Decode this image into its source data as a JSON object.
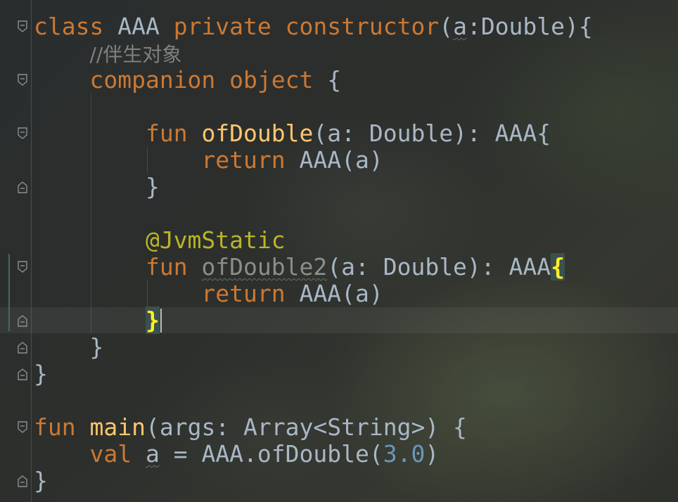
{
  "editor": {
    "language": "Kotlin",
    "colors": {
      "keyword": "#cc7832",
      "function": "#ffc66d",
      "plain": "#a9b7c6",
      "comment": "#808080",
      "annotation": "#bbb529",
      "number": "#6897bb",
      "brace_match": "#ffef28"
    },
    "current_line": 12,
    "lines": [
      {
        "n": 1,
        "tokens": [
          [
            "kw",
            "class "
          ],
          [
            "pl",
            "AAA "
          ],
          [
            "kw",
            "private constructor"
          ],
          [
            "pl",
            "("
          ],
          [
            "weak",
            "a"
          ],
          [
            "pl",
            ":Double){"
          ]
        ]
      },
      {
        "n": 2,
        "tokens": [
          [
            "pl",
            "    "
          ],
          [
            "cm",
            "//伴生对象"
          ]
        ]
      },
      {
        "n": 3,
        "tokens": [
          [
            "pl",
            "    "
          ],
          [
            "kw",
            "companion object "
          ],
          [
            "pl",
            "{"
          ]
        ]
      },
      {
        "n": 4,
        "tokens": []
      },
      {
        "n": 5,
        "tokens": [
          [
            "pl",
            "        "
          ],
          [
            "kw",
            "fun "
          ],
          [
            "fn",
            "ofDouble"
          ],
          [
            "pl",
            "(a: Double): AAA{"
          ]
        ]
      },
      {
        "n": 6,
        "tokens": [
          [
            "pl",
            "            "
          ],
          [
            "kw",
            "return "
          ],
          [
            "pl",
            "AAA(a)"
          ]
        ]
      },
      {
        "n": 7,
        "tokens": [
          [
            "pl",
            "        }"
          ]
        ]
      },
      {
        "n": 8,
        "tokens": []
      },
      {
        "n": 9,
        "tokens": [
          [
            "pl",
            "        "
          ],
          [
            "an",
            "@JvmStatic"
          ]
        ]
      },
      {
        "n": 10,
        "tokens": [
          [
            "pl",
            "        "
          ],
          [
            "kw",
            "fun "
          ],
          [
            "unused",
            "ofDouble2"
          ],
          [
            "pl",
            "(a: Double): AAA"
          ],
          [
            "brace",
            "{"
          ]
        ]
      },
      {
        "n": 11,
        "tokens": [
          [
            "pl",
            "            "
          ],
          [
            "kw",
            "return "
          ],
          [
            "pl",
            "AAA(a)"
          ]
        ]
      },
      {
        "n": 12,
        "tokens": [
          [
            "pl",
            "        "
          ],
          [
            "brace",
            "}"
          ],
          [
            "caret",
            ""
          ]
        ]
      },
      {
        "n": 13,
        "tokens": [
          [
            "pl",
            "    }"
          ]
        ]
      },
      {
        "n": 14,
        "tokens": [
          [
            "pl",
            "}"
          ]
        ]
      },
      {
        "n": 15,
        "tokens": []
      },
      {
        "n": 16,
        "tokens": [
          [
            "kw",
            "fun "
          ],
          [
            "fn",
            "main"
          ],
          [
            "pl",
            "(args: Array<String>) {"
          ]
        ]
      },
      {
        "n": 17,
        "tokens": [
          [
            "pl",
            "    "
          ],
          [
            "kw",
            "val "
          ],
          [
            "weak",
            "a"
          ],
          [
            "pl",
            " = AAA.ofDouble("
          ],
          [
            "num",
            "3.0"
          ],
          [
            "pl",
            ")"
          ]
        ]
      },
      {
        "n": 18,
        "tokens": [
          [
            "pl",
            "}"
          ]
        ]
      }
    ]
  },
  "gutter": {
    "fold_markers": [
      {
        "line": 1,
        "kind": "fold-open"
      },
      {
        "line": 3,
        "kind": "fold-open"
      },
      {
        "line": 5,
        "kind": "fold-open"
      },
      {
        "line": 7,
        "kind": "fold-close"
      },
      {
        "line": 10,
        "kind": "fold-open"
      },
      {
        "line": 12,
        "kind": "fold-close"
      },
      {
        "line": 13,
        "kind": "fold-close"
      },
      {
        "line": 14,
        "kind": "fold-close"
      },
      {
        "line": 16,
        "kind": "fold-open"
      },
      {
        "line": 18,
        "kind": "fold-close"
      }
    ]
  }
}
